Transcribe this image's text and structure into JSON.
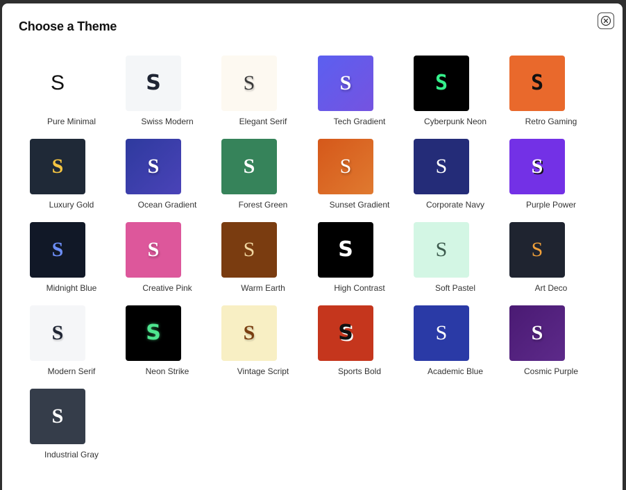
{
  "dialog": {
    "title": "Choose a Theme",
    "close_icon": "close-icon"
  },
  "themes": [
    {
      "name": "Pure Minimal",
      "letter": "S",
      "bg": "#ffffff",
      "fg": "#111111",
      "font": "f-sans-light",
      "shadow": "none"
    },
    {
      "name": "Swiss Modern",
      "letter": "S",
      "bg": "#f4f6f8",
      "fg": "#1e2433",
      "font": "f-sans f-bold",
      "shadow": "none"
    },
    {
      "name": "Elegant Serif",
      "letter": "S",
      "bg": "#fdf9f1",
      "fg": "#3b3b3b",
      "font": "f-serif",
      "shadow": "1px 2px 2px rgba(0,0,0,0.25)"
    },
    {
      "name": "Tech Gradient",
      "letter": "S",
      "bg": "linear-gradient(135deg,#5b5ff0,#7553e0)",
      "fg": "#ffffff",
      "font": "f-serif f-bold",
      "shadow": "1px 2px 3px rgba(0,0,0,0.3)"
    },
    {
      "name": "Cyberpunk Neon",
      "letter": "S",
      "bg": "#000000",
      "fg": "#35f08b",
      "font": "f-mono",
      "shadow": "none"
    },
    {
      "name": "Retro Gaming",
      "letter": "S",
      "bg": "#e9692c",
      "fg": "#111111",
      "font": "f-mono",
      "shadow": "none"
    },
    {
      "name": "Luxury Gold",
      "letter": "S",
      "bg": "#1f2937",
      "fg": "#f5c542",
      "font": "f-serif f-bold",
      "shadow": "none"
    },
    {
      "name": "Ocean Gradient",
      "letter": "S",
      "bg": "linear-gradient(135deg,#2e3a9e,#4a43b8)",
      "fg": "#ffffff",
      "font": "f-serif f-bold",
      "shadow": "1px 2px 3px rgba(0,0,0,0.3)"
    },
    {
      "name": "Forest Green",
      "letter": "S",
      "bg": "#36835a",
      "fg": "#ffffff",
      "font": "f-serif f-bold",
      "shadow": "none"
    },
    {
      "name": "Sunset Gradient",
      "letter": "S",
      "bg": "linear-gradient(135deg,#d5581a,#e07a30)",
      "fg": "#ffffff",
      "font": "f-serif",
      "shadow": "1px 2px 3px rgba(0,0,0,0.3)"
    },
    {
      "name": "Corporate Navy",
      "letter": "S",
      "bg": "#242c78",
      "fg": "#ffffff",
      "font": "f-serif",
      "shadow": "none"
    },
    {
      "name": "Purple Power",
      "letter": "S",
      "bg": "#7331e6",
      "fg": "#ffffff",
      "font": "f-serif f-bold",
      "shadow": "2px 2px 0 #111111"
    },
    {
      "name": "Midnight Blue",
      "letter": "S",
      "bg": "#111827",
      "fg": "#6c8df5",
      "font": "f-serif f-bold",
      "shadow": "none"
    },
    {
      "name": "Creative Pink",
      "letter": "S",
      "bg": "#dd579b",
      "fg": "#ffffff",
      "font": "f-serif f-bold",
      "shadow": "1px 2px 3px rgba(0,0,0,0.3)"
    },
    {
      "name": "Warm Earth",
      "letter": "S",
      "bg": "#7a3c10",
      "fg": "#f0d6a0",
      "font": "f-serif",
      "shadow": "none"
    },
    {
      "name": "High Contrast",
      "letter": "S",
      "bg": "#000000",
      "fg": "#ffffff",
      "font": "f-sans f-bold",
      "shadow": "none"
    },
    {
      "name": "Soft Pastel",
      "letter": "S",
      "bg": "#d3f6e4",
      "fg": "#3c5a4d",
      "font": "f-serif",
      "shadow": "none"
    },
    {
      "name": "Art Deco",
      "letter": "S",
      "bg": "#1f2430",
      "fg": "#f0a03a",
      "font": "f-serif",
      "shadow": "none"
    },
    {
      "name": "Modern Serif",
      "letter": "S",
      "bg": "#f5f6f8",
      "fg": "#1e2433",
      "font": "f-serif f-bold",
      "shadow": "1px 2px 2px rgba(0,0,0,0.2)"
    },
    {
      "name": "Neon Strike",
      "letter": "S",
      "bg": "#000000",
      "fg": "#4ee58f",
      "font": "f-sans f-bold",
      "shadow": "0 0 4px rgba(78,229,143,0.6)"
    },
    {
      "name": "Vintage Script",
      "letter": "S",
      "bg": "#f8efc4",
      "fg": "#7a3e10",
      "font": "f-serif f-bold",
      "shadow": "1px 2px 2px rgba(0,0,0,0.2)"
    },
    {
      "name": "Sports Bold",
      "letter": "S",
      "bg": "#c5361d",
      "fg": "#111111",
      "font": "f-sans f-bold",
      "shadow": "2px 2px 0 #ffffff"
    },
    {
      "name": "Academic Blue",
      "letter": "S",
      "bg": "#2a3aa6",
      "fg": "#ffffff",
      "font": "f-serif",
      "shadow": "none"
    },
    {
      "name": "Cosmic Purple",
      "letter": "S",
      "bg": "linear-gradient(135deg,#4a1a73,#5d2a8a)",
      "fg": "#ffffff",
      "font": "f-serif f-bold",
      "shadow": "1px 2px 3px rgba(0,0,0,0.3)"
    },
    {
      "name": "Industrial Gray",
      "letter": "S",
      "bg": "#353d4a",
      "fg": "#ffffff",
      "font": "f-serif f-bold",
      "shadow": "none"
    }
  ]
}
